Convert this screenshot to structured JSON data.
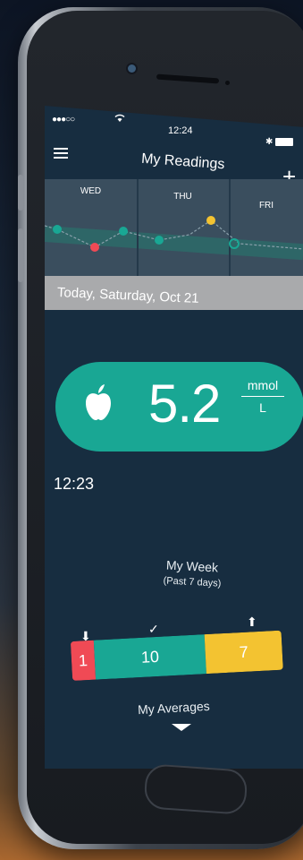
{
  "status_bar": {
    "signal": "●●●○○",
    "time": "12:24"
  },
  "nav": {
    "title": "My Readings"
  },
  "week_strip": {
    "days": [
      "WED",
      "THU",
      "FRI"
    ]
  },
  "date_header": "Today, Saturday, Oct 21",
  "reading": {
    "value": "5.2",
    "unit_top": "mmol",
    "unit_bottom": "L",
    "time": "12:23"
  },
  "my_week": {
    "title": "My Week",
    "subtitle": "(Past 7 days)",
    "low_count": "1",
    "in_range_count": "10",
    "high_count": "7"
  },
  "averages": {
    "label": "My Averages"
  },
  "colors": {
    "teal": "#19a794",
    "red": "#f04a55",
    "yellow": "#f3c331",
    "screen_bg": "#172d40"
  }
}
